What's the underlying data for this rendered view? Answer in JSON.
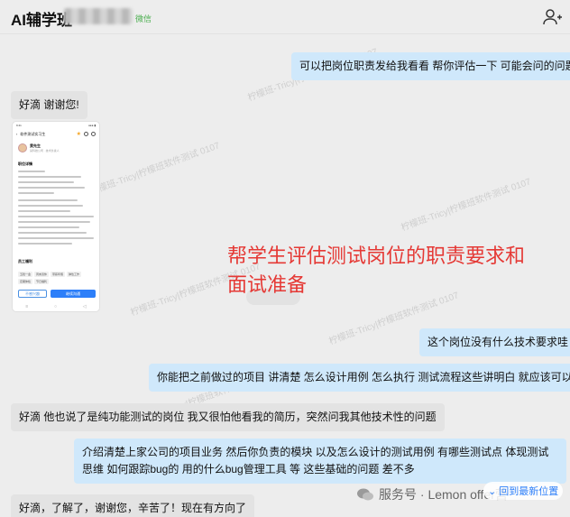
{
  "header": {
    "title": "AI辅学班",
    "wechat_tag": "微信",
    "add_member_icon": "add-user-icon"
  },
  "messages": [
    {
      "side": "right",
      "text": "可以把岗位职责发给我看看  帮你评估一下 可能会问的问题"
    },
    {
      "side": "left",
      "text": "好滴 谢谢您!"
    },
    {
      "side": "right",
      "text": "这个岗位没有什么技术要求哇"
    },
    {
      "side": "right",
      "text": "你能把之前做过的项目 讲清楚  怎么设计用例 怎么执行  测试流程这些讲明白  就应该可以"
    },
    {
      "side": "left",
      "text": "好滴 他也说了是纯功能测试的岗位 我又很怕他看我的简历，突然问我其他技术性的问题"
    },
    {
      "side": "right",
      "text": "介绍清楚上家公司的项目业务 然后你负责的模块  以及怎么设计的测试用例 有哪些测试点  体现测试思维 如何跟踪bug的  用的什么bug管理工具 等 这些基础的问题 差不多"
    },
    {
      "side": "left",
      "text": "好滴，了解了，谢谢您，辛苦了！现在有方向了"
    }
  ],
  "job_screenshot": {
    "status_left": "9:41",
    "status_right": "●●● ▮",
    "header_title": "软件测试实习生",
    "person_name": "黄先生",
    "person_sub": "某科技公司 · 技术负责人",
    "section_desc": "职位详情",
    "section_tags": "员工福利",
    "tags": [
      "五险一金",
      "周末双休",
      "带薪年假",
      "弹性工作",
      "定期体检",
      "节日福利"
    ],
    "button_secondary": "不感兴趣",
    "button_primary": "继续沟通"
  },
  "overlay_text": {
    "line1": "帮学生评估测试岗位的职责要求和",
    "line2": "面试准备"
  },
  "watermark": "柠檬班-Tricy|柠檬班软件测试 0107",
  "footer": {
    "label": "服务号 · Lemon offer营",
    "new_position": "回到最新位置"
  },
  "colors": {
    "right_bubble": "#cfe8fb",
    "left_bubble": "#e3e3e3",
    "overlay_red": "#e53935",
    "link_blue": "#2d7ff9"
  }
}
